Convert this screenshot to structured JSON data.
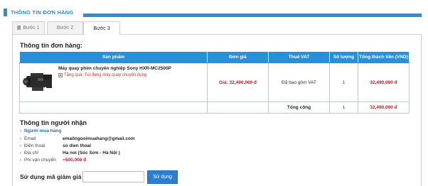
{
  "header": {
    "title": "THÔNG TIN ĐƠN HÀNG"
  },
  "tabs": [
    {
      "label": "Bước 1"
    },
    {
      "label": "Bước 2"
    },
    {
      "label": "Bước 3"
    }
  ],
  "order": {
    "title": "Thông tin đơn hàng:",
    "columns": [
      "Sản phẩm",
      "Đơn giá",
      "Thuế VAT",
      "Số lượng",
      "Tổng thành tiền (VND)"
    ],
    "item": {
      "name": "Máy quay phim chuyên nghiệp Sony HXR-MC2500P",
      "gift": "Tặng quà: Túi đựng máy quay chuyên dụng",
      "price": "Giá: 32,490,000 đ",
      "vat": "Đã bao gồm VAT",
      "qty": "1",
      "subtotal": "32,490,000 đ"
    },
    "total": {
      "label": "Tổng cộng",
      "qty": "1",
      "amount": "32,490,000 đ"
    }
  },
  "receiver": {
    "title": "Thông tin người nhận",
    "buyer_heading": "Người mua hàng",
    "fields": [
      {
        "label": "Email",
        "value": "emailnguoimuahang@gmail.com"
      },
      {
        "label": "Điện thoại",
        "value": "so dien thoai"
      },
      {
        "label": "Địa chỉ",
        "value": "Ha noi (Sóc Sơn - Hà Nội )"
      },
      {
        "label": "Phí vận chuyển",
        "value": "+500,000 đ"
      }
    ]
  },
  "discount": {
    "label": "Sử dụng mã giảm giá :",
    "input_value": "",
    "button_label": "Sử dụng"
  },
  "colors": {
    "accent": "#2a8fd6",
    "price": "#b0202a",
    "button": "#2a7fd0"
  }
}
